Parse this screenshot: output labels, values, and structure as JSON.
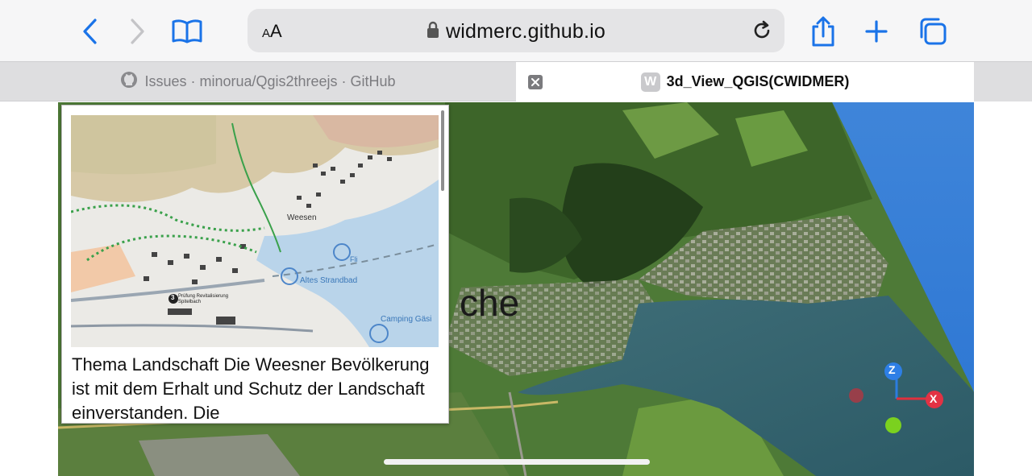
{
  "toolbar": {
    "text_size_label": "AA",
    "url": "widmerc.github.io",
    "icons": [
      "back-icon",
      "forward-icon",
      "bookmarks-icon",
      "lock-icon",
      "reload-icon",
      "share-icon",
      "plus-icon",
      "tabs-icon"
    ],
    "accent_color": "#1a73e8"
  },
  "tabs": [
    {
      "title": "Issues · minorua/Qgis2threejs · GitHub",
      "active": false,
      "favicon": "github-icon"
    },
    {
      "title": "3d_View_QGIS(CWIDMER)",
      "active": true,
      "favicon_letter": "W"
    }
  ],
  "content": {
    "label_fragment": "che",
    "popup": {
      "text": "Thema Landschaft Die Weesner Bevölkerung ist mit dem Erhalt und Schutz der Landschaft einverstanden. Die",
      "map_labels": [
        "Weesen",
        "Fli",
        "Altes Strandbad",
        "Camping Gäsi",
        "Prüfung Revitalisierung Spitelbach",
        "3"
      ]
    },
    "axes": {
      "z_label": "Z",
      "x_label": "X"
    }
  }
}
